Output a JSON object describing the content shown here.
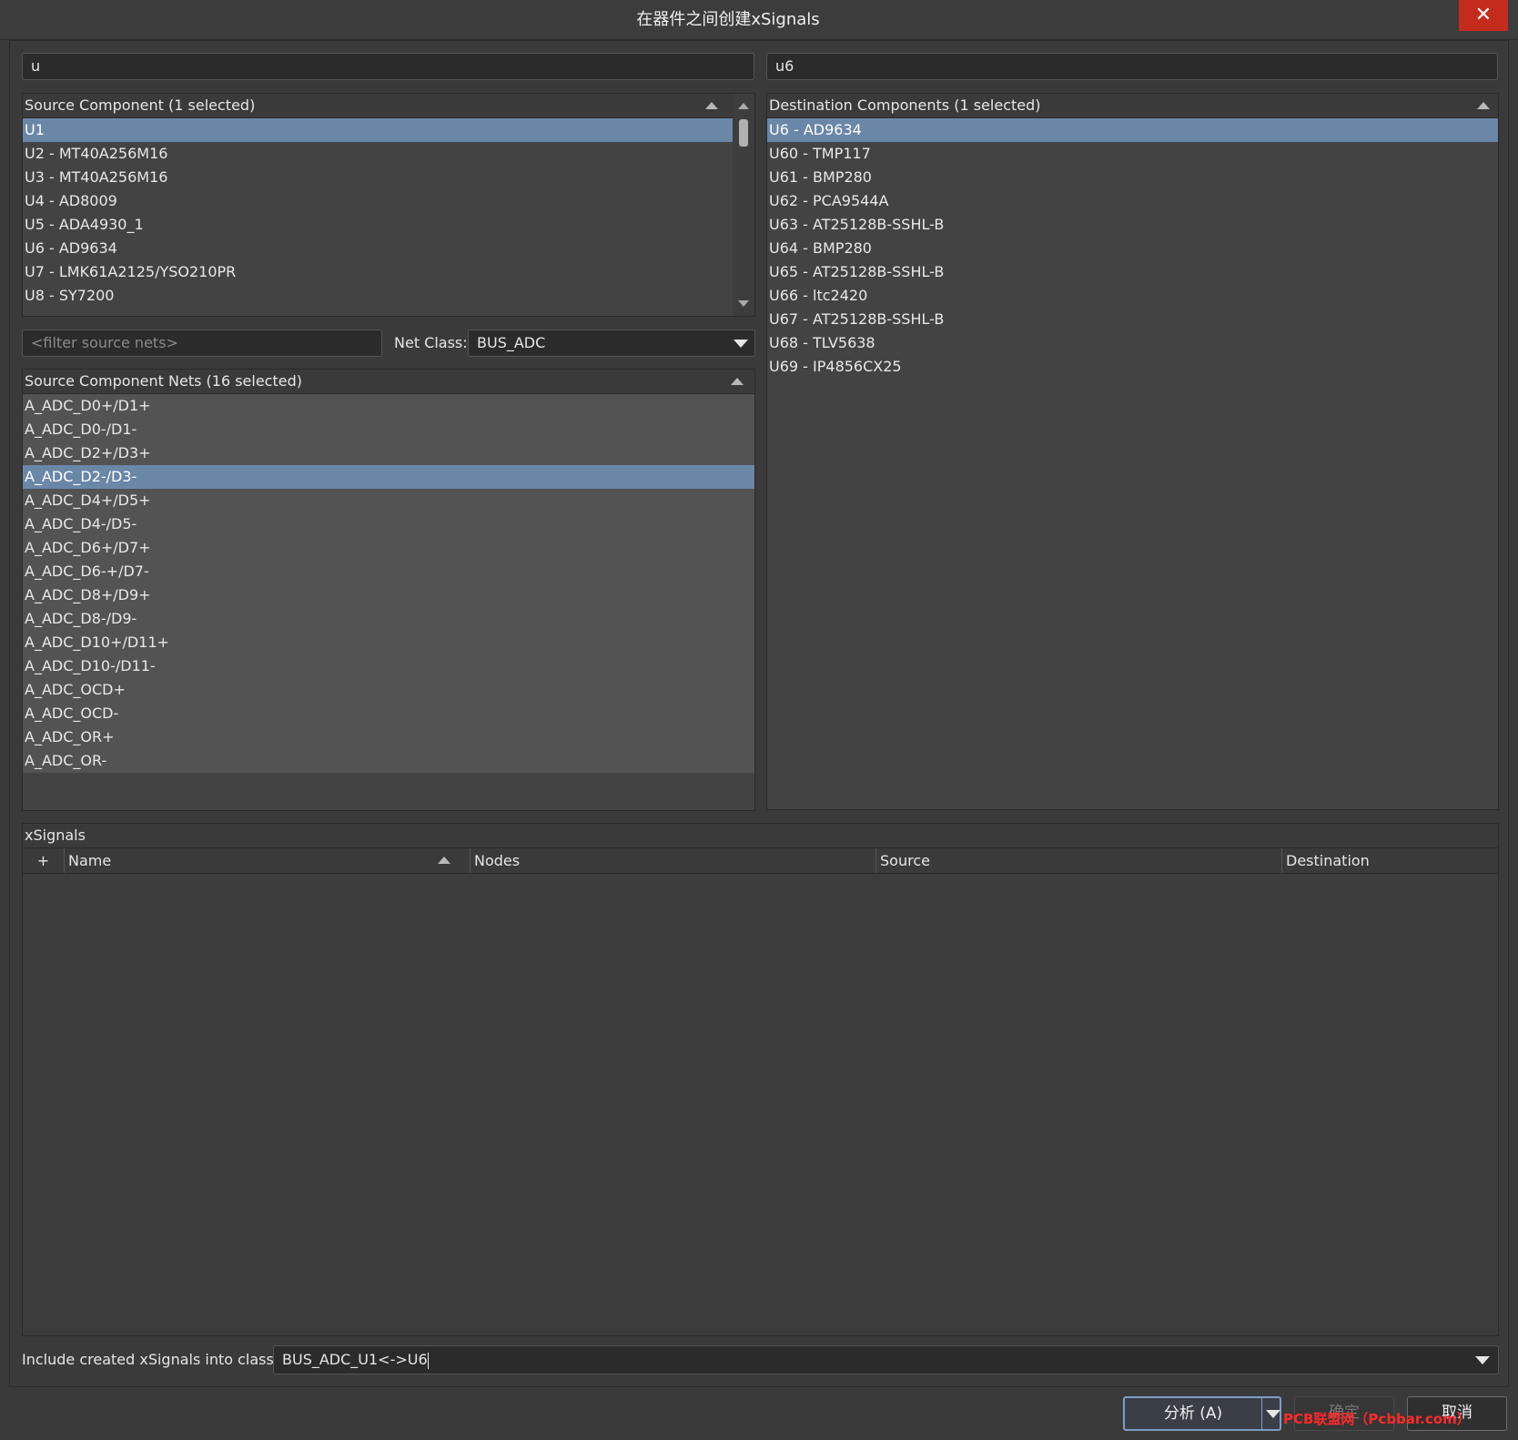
{
  "window": {
    "title": "在器件之间创建xSignals",
    "close_glyph": "✕"
  },
  "source_filter": {
    "value": "u"
  },
  "dest_filter": {
    "value": "u6"
  },
  "source_components": {
    "header": "Source Component (1 selected)",
    "items": [
      "U1",
      "U2 - MT40A256M16",
      "U3 - MT40A256M16",
      "U4 - AD8009",
      "U5 - ADA4930_1",
      "U6 - AD9634",
      "U7 - LMK61A2125/YSO210PR",
      "U8 - SY7200"
    ],
    "selected_index": 0
  },
  "dest_components": {
    "header": "Destination Components (1 selected)",
    "items": [
      "U6 - AD9634",
      "U60 - TMP117",
      "U61 - BMP280",
      "U62 - PCA9544A",
      "U63 - AT25128B-SSHL-B",
      "U64 - BMP280",
      "U65 - AT25128B-SSHL-B",
      "U66 - ltc2420",
      "U67 - AT25128B-SSHL-B",
      "U68 - TLV5638",
      "U69 - IP4856CX25"
    ],
    "selected_index": 0
  },
  "net_filter": {
    "placeholder": "<filter source nets>"
  },
  "net_class": {
    "label": "Net Class:",
    "value": "BUS_ADC"
  },
  "source_nets": {
    "header": "Source Component Nets (16 selected)",
    "items": [
      "A_ADC_D0+/D1+",
      "A_ADC_D0-/D1-",
      "A_ADC_D2+/D3+",
      "A_ADC_D2-/D3-",
      "A_ADC_D4+/D5+",
      "A_ADC_D4-/D5-",
      "A_ADC_D6+/D7+",
      "A_ADC_D6-+/D7-",
      "A_ADC_D8+/D9+",
      "A_ADC_D8-/D9-",
      "A_ADC_D10+/D11+",
      "A_ADC_D10-/D11-",
      "A_ADC_OCD+",
      "A_ADC_OCD-",
      "A_ADC_OR+",
      "A_ADC_OR-"
    ],
    "highlight_index": 3
  },
  "xsignals": {
    "header": "xSignals",
    "columns": {
      "plus": "+",
      "name": "Name",
      "nodes": "Nodes",
      "source": "Source",
      "destination": "Destination"
    }
  },
  "include_class": {
    "label": "Include created xSignals into class:",
    "value": "BUS_ADC_U1<->U6"
  },
  "buttons": {
    "analyze": "分析 (A)",
    "ok": "确定",
    "cancel": "取消"
  },
  "watermark": "PCB联盟网（Pcbbar.com）",
  "colors": {
    "selection": "#6a87a8",
    "close": "#c42b1c",
    "primary_border": "#7f9cc4"
  }
}
